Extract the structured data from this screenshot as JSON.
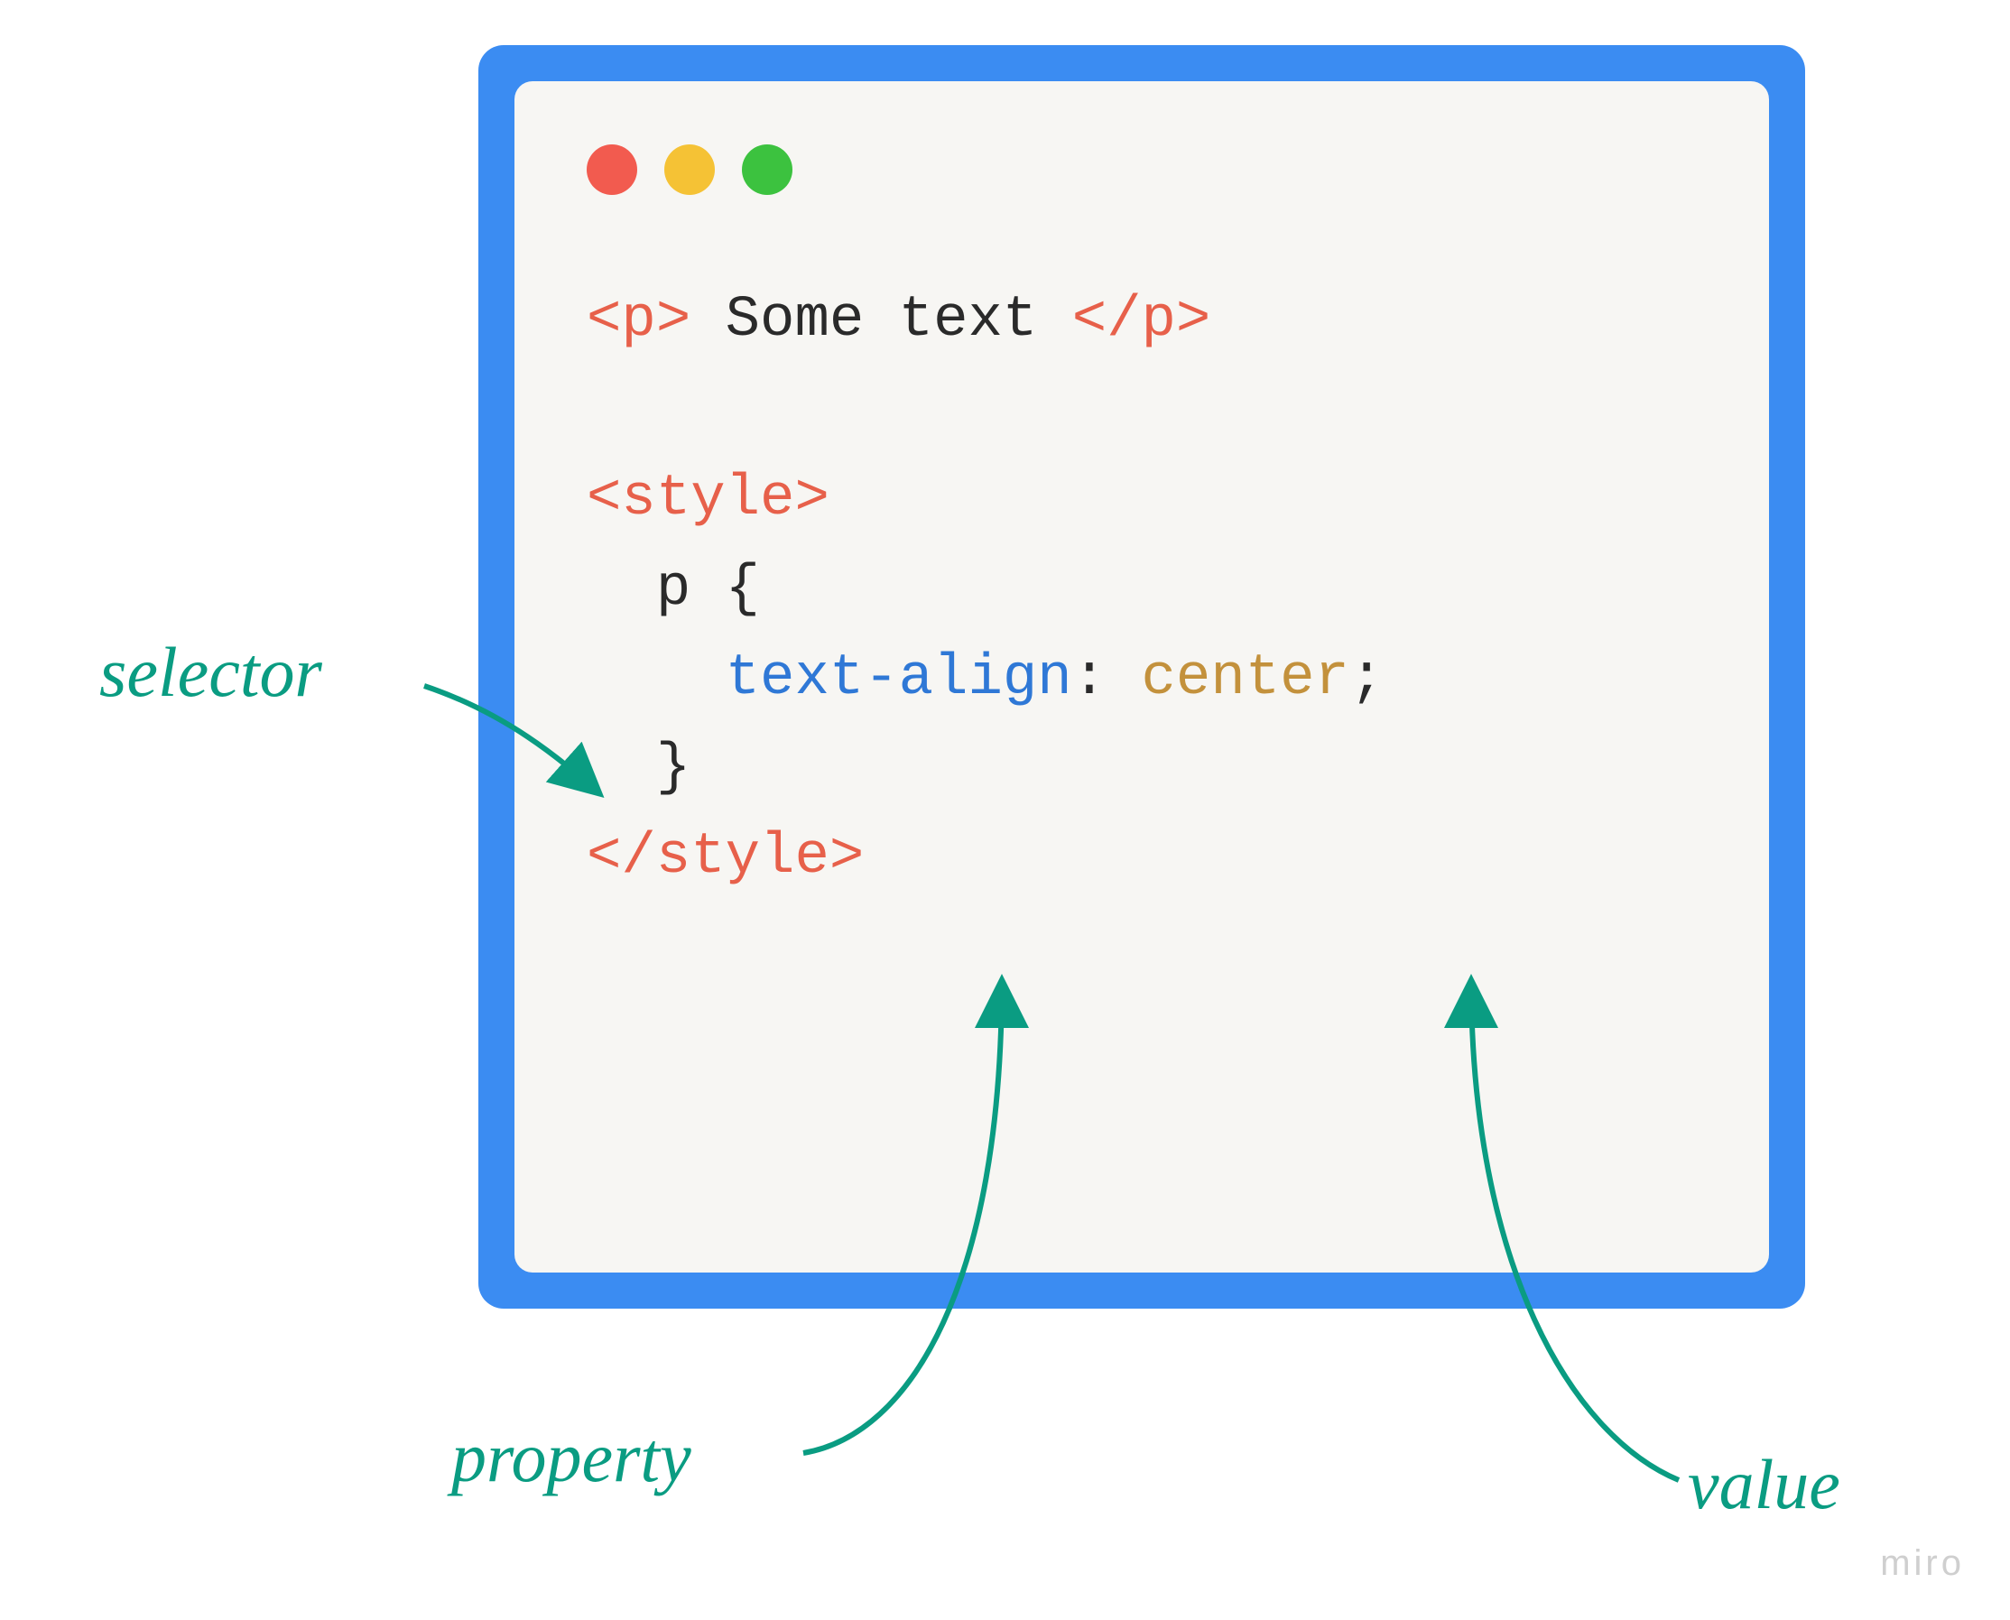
{
  "labels": {
    "selector": "selector",
    "property": "property",
    "value": "value"
  },
  "code": {
    "line1_open": "<p>",
    "line1_text": " Some text ",
    "line1_close": "</p>",
    "line2_open": "<style>",
    "selector": "p",
    "brace_open": " {",
    "property": "text-align",
    "colon": ": ",
    "value_text": "center",
    "semicolon": ";",
    "brace_close": "}",
    "line_close": "</style>"
  },
  "watermark": "miro",
  "colors": {
    "frame": "#3b8cf2",
    "panel": "#f7f6f3",
    "label": "#0a9c82",
    "tag": "#e7604a",
    "prop": "#2f78d6",
    "val": "#c3913c"
  }
}
